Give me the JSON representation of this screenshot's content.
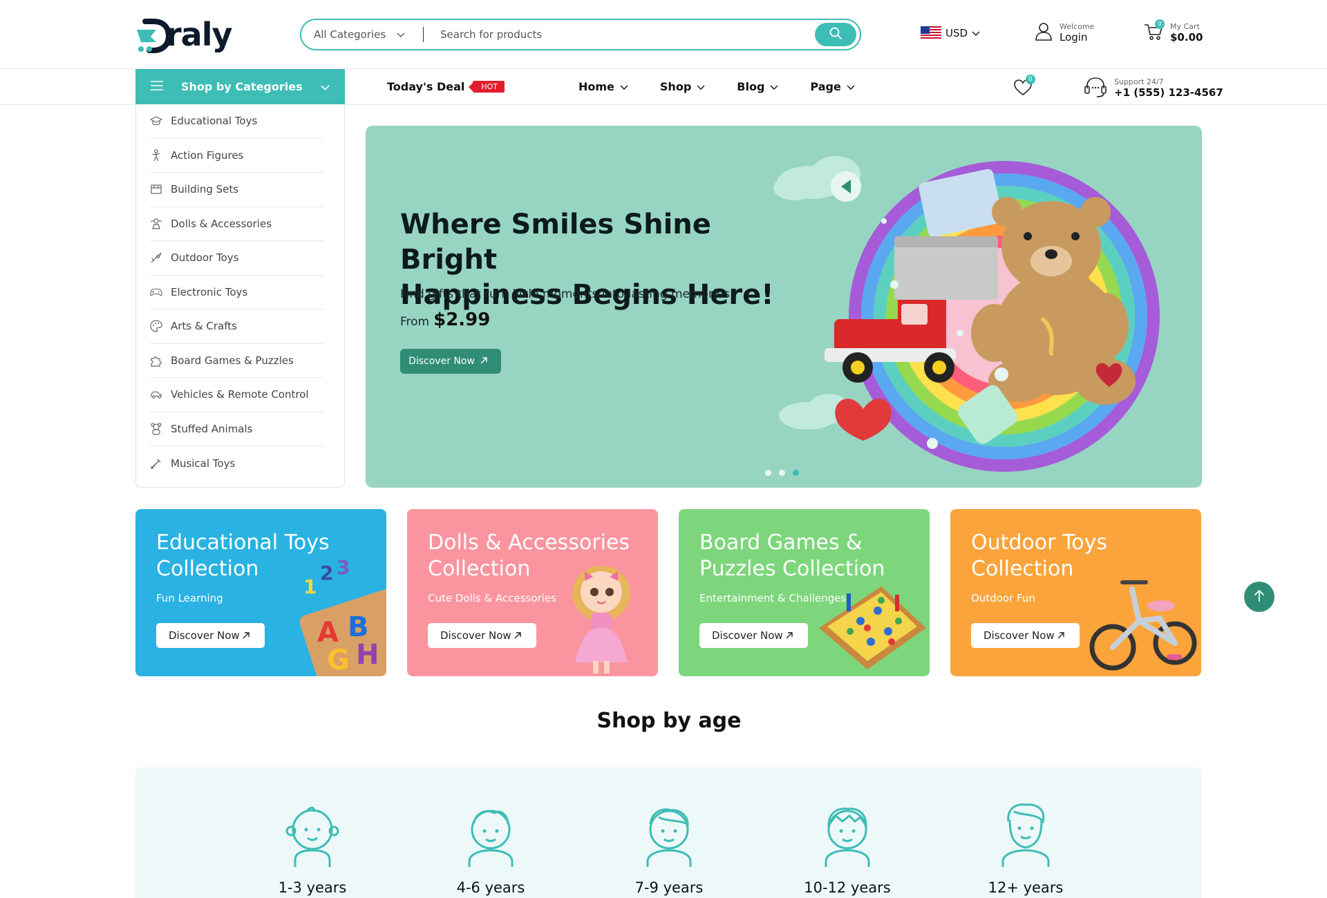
{
  "brand": {
    "name": "Draly",
    "logo_text": "raly",
    "accent": "#3dbdb5",
    "dark_accent": "#2f8d75"
  },
  "search": {
    "category": "All Categories",
    "placeholder": "Search for products"
  },
  "currency": {
    "code": "USD"
  },
  "account": {
    "welcome": "Welcome",
    "action": "Login"
  },
  "cart": {
    "label": "My Cart",
    "total": "$0.00",
    "count": "0"
  },
  "nav": {
    "shop_by_categories": "Shop by Categories",
    "todays_deal": "Today's Deal",
    "hot_badge": "HOT",
    "links": [
      "Home",
      "Shop",
      "Blog",
      "Page"
    ],
    "wishlist_count": "0",
    "support_label": "Support 24/7",
    "support_phone": "+1 (555) 123-4567"
  },
  "categories": [
    {
      "label": "Educational Toys",
      "icon": "graduation-cap-icon"
    },
    {
      "label": "Action Figures",
      "icon": "action-figure-icon"
    },
    {
      "label": "Building Sets",
      "icon": "building-blocks-icon"
    },
    {
      "label": "Dolls & Accessories",
      "icon": "doll-icon"
    },
    {
      "label": "Outdoor Toys",
      "icon": "outdoor-icon"
    },
    {
      "label": "Electronic Toys",
      "icon": "gamepad-icon"
    },
    {
      "label": "Arts & Crafts",
      "icon": "palette-icon"
    },
    {
      "label": "Board Games & Puzzles",
      "icon": "puzzle-icon"
    },
    {
      "label": "Vehicles & Remote Control",
      "icon": "car-icon"
    },
    {
      "label": "Stuffed Animals",
      "icon": "teddy-icon"
    },
    {
      "label": "Musical Toys",
      "icon": "music-icon"
    }
  ],
  "hero": {
    "headline_1": "Where Smiles Shine Bright",
    "headline_2": "Happiness Begins Here!",
    "subtitle": "Find gifts that turn little moments into lasting memories!",
    "price_prefix": "From",
    "price": "$2.99",
    "cta": "Discover Now",
    "slides": 3,
    "active_slide": 3,
    "bg_color": "#97d5c2"
  },
  "promos": [
    {
      "title": "Educational Toys Collection",
      "tagline": "Fun Learning",
      "cta": "Discover Now",
      "color": "#29b2e2"
    },
    {
      "title": "Dolls & Accessories Collection",
      "tagline": "Cute Dolls & Accessories",
      "cta": "Discover Now",
      "color": "#fa959f"
    },
    {
      "title": "Board Games & Puzzles Collection",
      "tagline": "Entertainment & Challenges",
      "cta": "Discover Now",
      "color": "#7dd67b"
    },
    {
      "title": "Outdoor Toys Collection",
      "tagline": "Outdoor Fun",
      "cta": "Discover Now",
      "color": "#fba43c"
    }
  ],
  "shop_by_age": {
    "title": "Shop by age",
    "groups": [
      "1-3 years",
      "4-6 years",
      "7-9 years",
      "10-12 years",
      "12+ years"
    ]
  }
}
